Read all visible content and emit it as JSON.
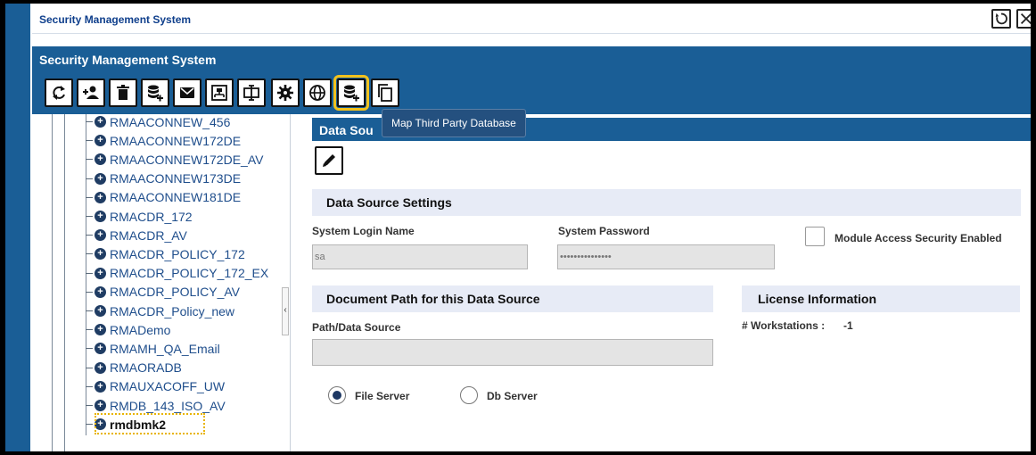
{
  "window": {
    "title": "Security Management System"
  },
  "app": {
    "header_title": "Security Management System"
  },
  "toolbar": {
    "buttons": [
      {
        "icon": "refresh-icon",
        "label": "Refresh"
      },
      {
        "icon": "add-user-icon",
        "label": "Add User"
      },
      {
        "icon": "trash-icon",
        "label": "Delete"
      },
      {
        "icon": "add-database-icon",
        "label": "Add Data Source"
      },
      {
        "icon": "email-icon",
        "label": "Email"
      },
      {
        "icon": "hierarchy-icon",
        "label": "Organization"
      },
      {
        "icon": "text-field-icon",
        "label": "Field"
      },
      {
        "icon": "gear-icon",
        "label": "Settings"
      },
      {
        "icon": "globe-icon",
        "label": "Globe"
      },
      {
        "icon": "map-database-icon",
        "label": "Map Third Party Database"
      },
      {
        "icon": "copy-icon",
        "label": "Copy"
      }
    ],
    "tooltip": "Map Third Party Database"
  },
  "tree": {
    "items": [
      "RMAACONNEW_456",
      "RMAACONNEW172DE",
      "RMAACONNEW172DE_AV",
      "RMAACONNEW173DE",
      "RMAACONNEW181DE",
      "RMACDR_172",
      "RMACDR_AV",
      "RMACDR_POLICY_172",
      "RMACDR_POLICY_172_EX",
      "RMACDR_POLICY_AV",
      "RMACDR_Policy_new",
      "RMADemo",
      "RMAMH_QA_Email",
      "RMAORADB",
      "RMAUXACOFF_UW",
      "RMDB_143_ISO_AV",
      "rmdbmk2"
    ],
    "selected": "rmdbmk2"
  },
  "content": {
    "header_title": "Data Sou",
    "data_source_settings": {
      "title": "Data Source Settings",
      "login_label": "System Login Name",
      "login_value": "sa",
      "password_label": "System Password",
      "password_value": "•••••••••••••••",
      "module_access_label": "Module Access Security Enabled"
    },
    "document_path": {
      "title": "Document Path for this Data Source",
      "path_label": "Path/Data Source",
      "path_value": "",
      "options": [
        "File Server",
        "Db Server"
      ],
      "selected": "File Server"
    },
    "license": {
      "title": "License Information",
      "workstations_label": "# Workstations :",
      "workstations_value": "-1"
    }
  },
  "colors": {
    "primary": "#1a5e96",
    "highlight": "#f3c21c",
    "section_bg": "#e7ebf6"
  }
}
